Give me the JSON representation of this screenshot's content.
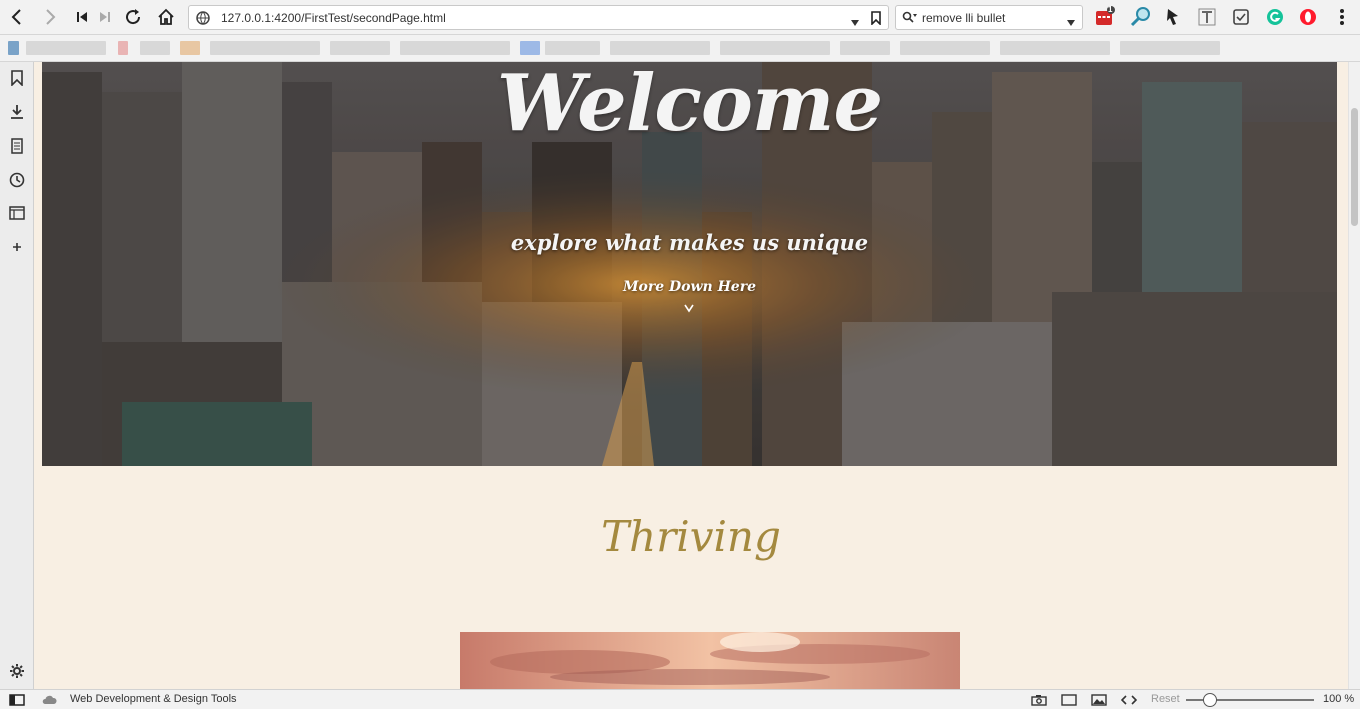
{
  "browser": {
    "url": "127.0.0.1:4200/FirstTest/secondPage.html",
    "search_query": "remove lli bullet",
    "extension_badge_count": "1"
  },
  "page": {
    "hero": {
      "title": "Welcome",
      "tagline": "explore what makes us unique",
      "more_link": "More Down Here",
      "more_arrow": "v"
    },
    "section_title": "Thriving"
  },
  "statusbar": {
    "label": "Web Development & Design Tools",
    "reset": "Reset",
    "zoom": "100 %"
  },
  "colors": {
    "page_background": "#f8efe3",
    "section_title": "#a4893f",
    "hero_text": "#f4f4f4"
  },
  "icons": {
    "toolbar": [
      "back-icon",
      "forward-icon",
      "rewind-icon",
      "fast-forward-icon",
      "reload-icon",
      "home-icon",
      "site-info-icon",
      "dropdown-icon",
      "bookmark-icon"
    ],
    "side_panel": [
      "bookmarks-icon",
      "downloads-icon",
      "notes-icon",
      "history-icon",
      "windows-icon",
      "add-panel-icon",
      "settings-icon"
    ],
    "statusbar": [
      "panel-toggle-icon",
      "cloud-icon",
      "camera-icon",
      "window-icon",
      "image-icon",
      "code-icon"
    ]
  }
}
